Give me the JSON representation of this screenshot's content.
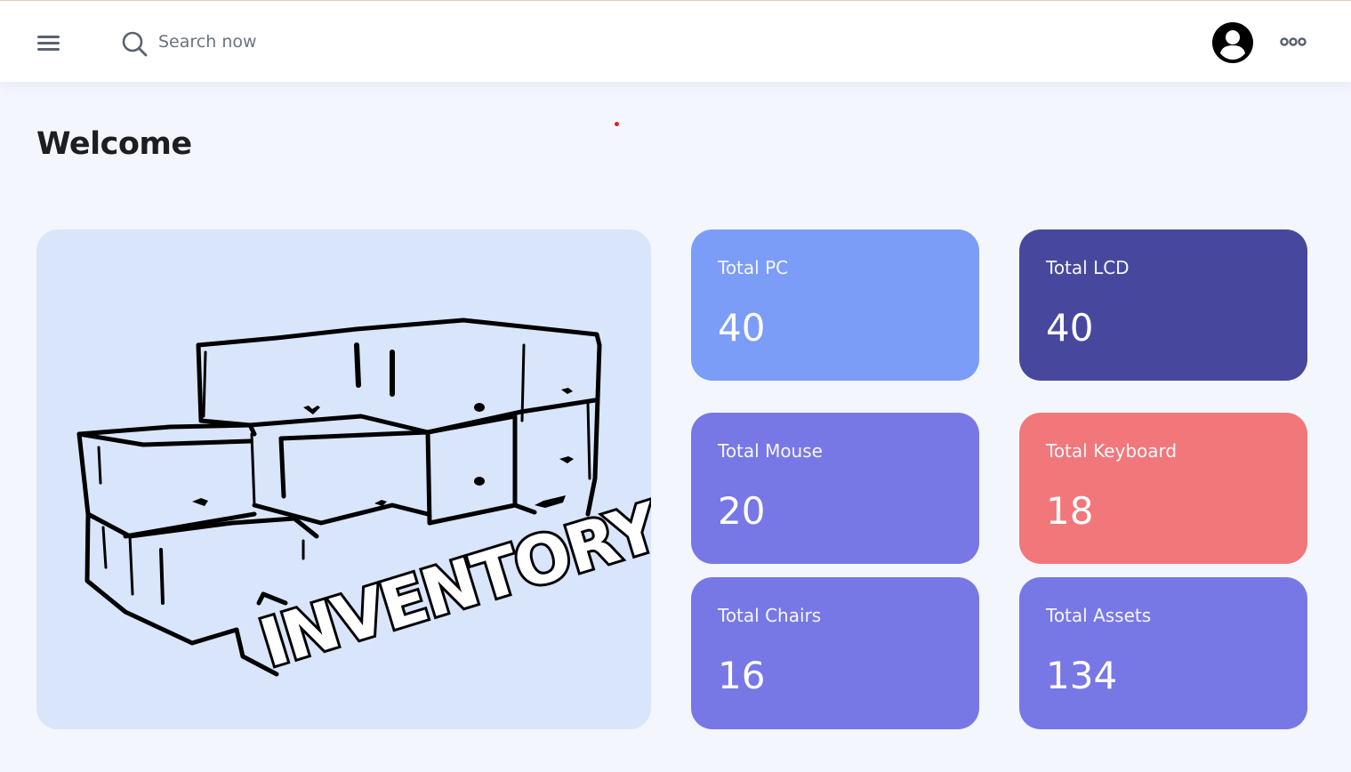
{
  "header": {
    "search_placeholder": "Search now",
    "menu_icon": "hamburger-menu-icon",
    "search_icon": "search-icon",
    "avatar_icon": "user-avatar-icon",
    "more_icon": "more-horizontal-icon"
  },
  "main": {
    "title": "Welcome",
    "hero_image_text": "INVENTORY"
  },
  "cards": [
    {
      "label": "Total PC",
      "value": "40",
      "color": "#7b9df8"
    },
    {
      "label": "Total LCD",
      "value": "40",
      "color": "#47489d"
    },
    {
      "label": "Total Mouse",
      "value": "20",
      "color": "#7778e6"
    },
    {
      "label": "Total Keyboard",
      "value": "18",
      "color": "#f2777a"
    },
    {
      "label": "Total Chairs",
      "value": "16",
      "color": "#7778e6"
    },
    {
      "label": "Total Assets",
      "value": "134",
      "color": "#7778e6"
    }
  ]
}
